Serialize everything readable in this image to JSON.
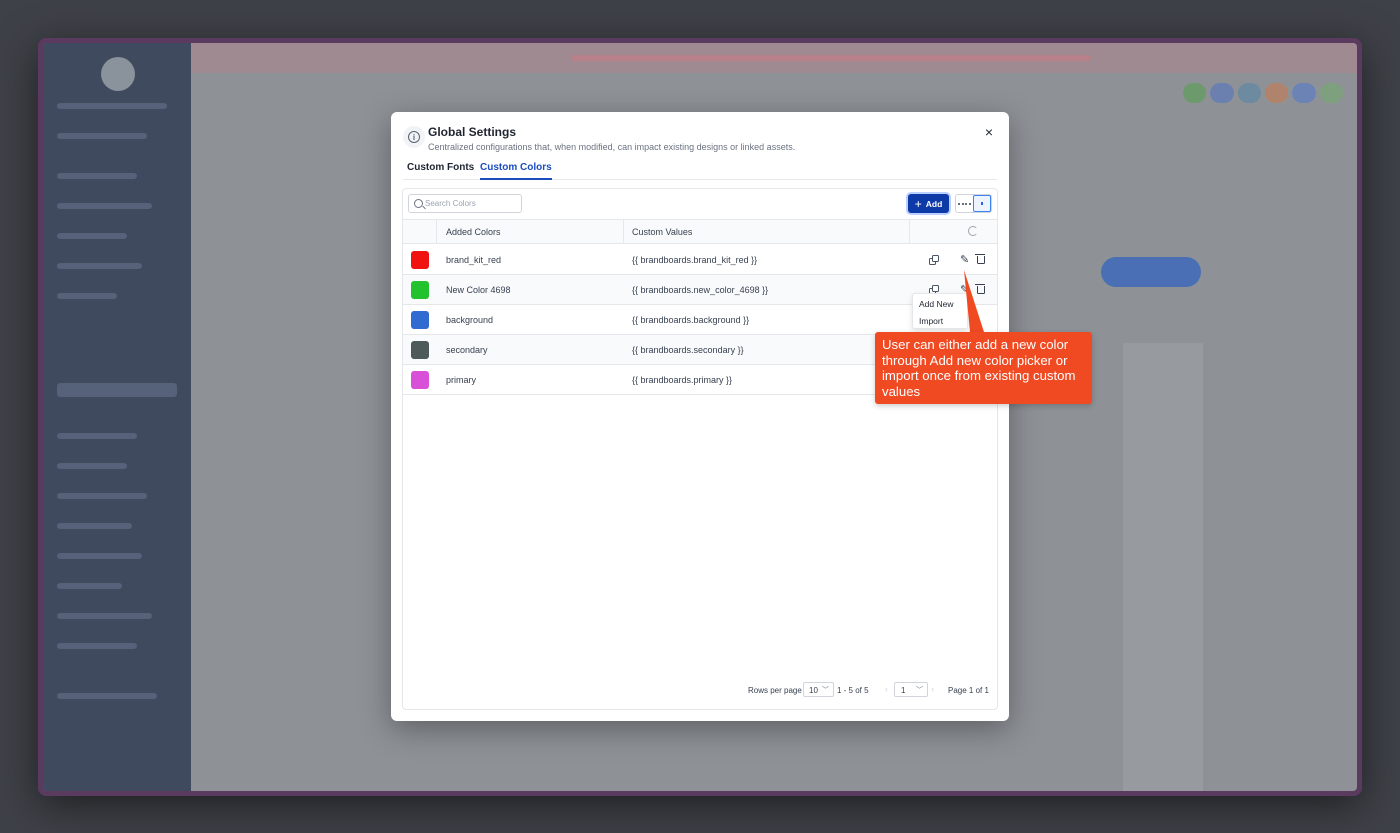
{
  "modal": {
    "title": "Global Settings",
    "subtitle": "Centralized configurations that, when modified, can impact existing designs or linked assets.",
    "close_label": "×"
  },
  "tabs": [
    {
      "label": "Custom Fonts",
      "active": false
    },
    {
      "label": "Custom Colors",
      "active": true
    }
  ],
  "toolbar": {
    "search_placeholder": "Search Colors",
    "add_label": "Add"
  },
  "add_menu": {
    "items": [
      "Add New",
      "Import"
    ]
  },
  "table": {
    "columns": [
      "Added Colors",
      "Custom Values"
    ],
    "rows": [
      {
        "name": "brand_kit_red",
        "value": "{{ brandboards.brand_kit_red }}",
        "color": "#f01111"
      },
      {
        "name": "New Color 4698",
        "value": "{{ brandboards.new_color_4698 }}",
        "color": "#22c22e"
      },
      {
        "name": "background",
        "value": "{{ brandboards.background }}",
        "color": "#2f6bd0"
      },
      {
        "name": "secondary",
        "value": "{{ brandboards.secondary }}",
        "color": "#4d5a5a"
      },
      {
        "name": "primary",
        "value": "{{ brandboards.primary }}",
        "color": "#d84fd8"
      }
    ]
  },
  "pagination": {
    "rows_per_page_label": "Rows per page",
    "rows_per_page": "10",
    "range": "1 - 5 of 5",
    "page": "1",
    "page_of": "Page 1 of 1"
  },
  "callout": {
    "text": "User can either add a new color through Add new color picker or import once from existing custom values"
  },
  "colors": {
    "accent": "#1b4dbf",
    "add_button": "#0d3aa6",
    "callout": "#f04a23"
  }
}
